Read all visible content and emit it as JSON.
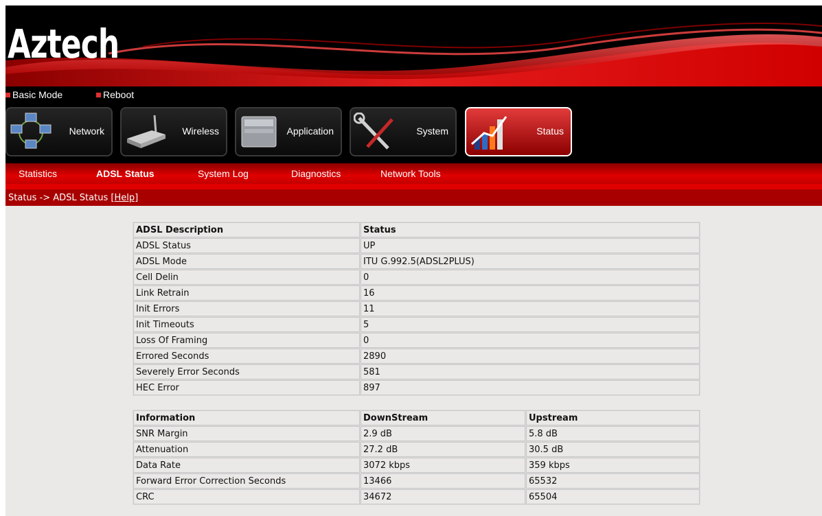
{
  "brand": {
    "logo": "Aztech"
  },
  "modebar": {
    "basic_mode": "Basic Mode",
    "reboot": "Reboot"
  },
  "nav": [
    {
      "label": "Network",
      "icon": "network-icon"
    },
    {
      "label": "Wireless",
      "icon": "router-icon"
    },
    {
      "label": "Application",
      "icon": "application-icon"
    },
    {
      "label": "System",
      "icon": "tools-icon"
    },
    {
      "label": "Status",
      "icon": "status-chart-icon",
      "active": true
    }
  ],
  "subnav": [
    "Statistics",
    "ADSL Status",
    "System Log",
    "Diagnostics",
    "Network Tools"
  ],
  "breadcrumb": {
    "path": "Status -> ADSL Status ",
    "help": "[Help]"
  },
  "adsl_table": {
    "headers": [
      "ADSL Description",
      "Status"
    ],
    "rows": [
      [
        "ADSL Status",
        "UP"
      ],
      [
        "ADSL Mode",
        "ITU G.992.5(ADSL2PLUS)"
      ],
      [
        "Cell Delin",
        "0"
      ],
      [
        "Link Retrain",
        "16"
      ],
      [
        "Init Errors",
        "11"
      ],
      [
        "Init Timeouts",
        "5"
      ],
      [
        "Loss Of Framing",
        "0"
      ],
      [
        "Errored Seconds",
        "2890"
      ],
      [
        "Severely Error Seconds",
        "581"
      ],
      [
        "HEC Error",
        "897"
      ]
    ]
  },
  "info_table": {
    "headers": [
      "Information",
      "DownStream",
      "Upstream"
    ],
    "rows": [
      [
        "SNR Margin",
        "2.9 dB",
        "5.8 dB"
      ],
      [
        "Attenuation",
        "27.2 dB",
        "30.5 dB"
      ],
      [
        "Data Rate",
        "3072 kbps",
        "359 kbps"
      ],
      [
        "Forward Error Correction Seconds",
        "13466",
        "65532"
      ],
      [
        "CRC",
        "34672",
        "65504"
      ]
    ]
  },
  "colors": {
    "brand_red": "#d60000",
    "header_bg": "#000000",
    "page_bg": "#ebe9e7"
  }
}
